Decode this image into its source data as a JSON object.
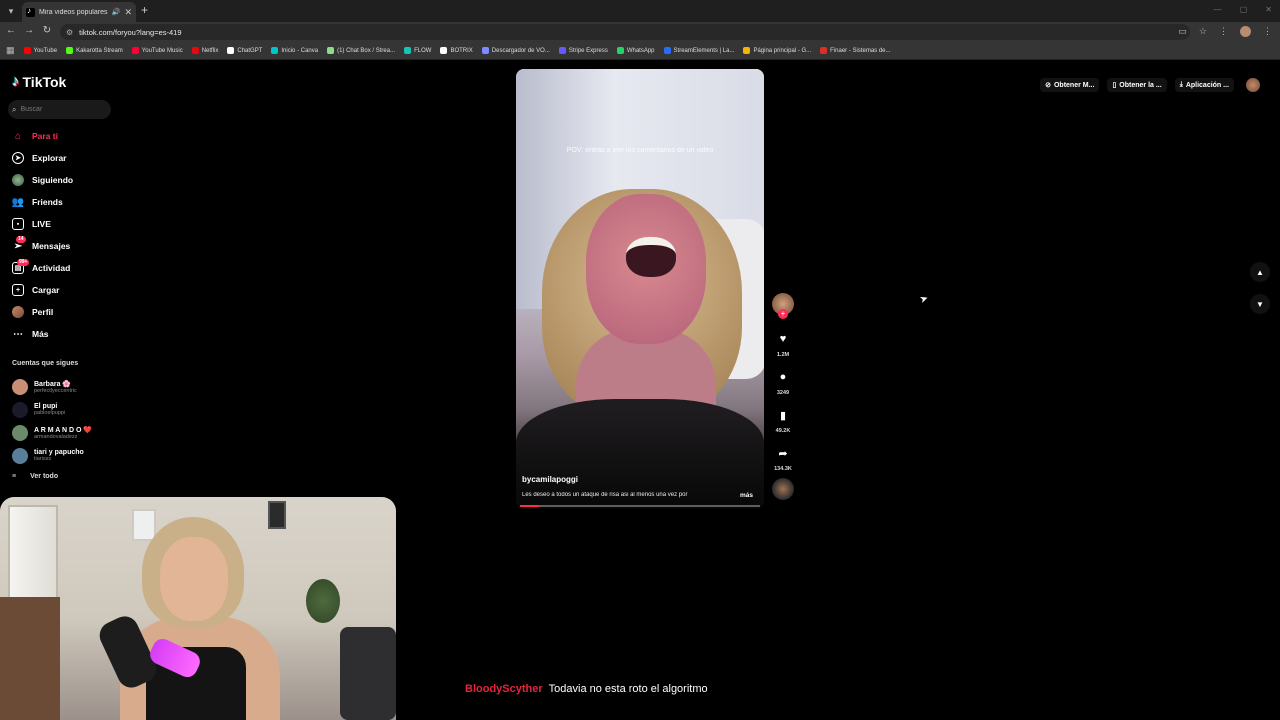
{
  "browser": {
    "tab_title": "Mira videos populares sele",
    "url": "tiktok.com/foryou?lang=es-419",
    "bookmarks": [
      {
        "label": "YouTube",
        "color": "#ff0000"
      },
      {
        "label": "Kakarotta Stream",
        "color": "#53fc18"
      },
      {
        "label": "YouTube Music",
        "color": "#ff0033"
      },
      {
        "label": "Netflix",
        "color": "#e50914"
      },
      {
        "label": "ChatGPT",
        "color": "#ffffff"
      },
      {
        "label": "Inicio - Canva",
        "color": "#00c4cc"
      },
      {
        "label": "(1) Chat Box / Strea...",
        "color": "#8bdd8b"
      },
      {
        "label": "FLOW",
        "color": "#17c3b2"
      },
      {
        "label": "BOTRIX",
        "color": "#ffffff"
      },
      {
        "label": "Descargador de VO...",
        "color": "#7c8cff"
      },
      {
        "label": "Stripe Express",
        "color": "#635bff"
      },
      {
        "label": "WhatsApp",
        "color": "#25d366"
      },
      {
        "label": "StreamElements | La...",
        "color": "#2a6df5"
      },
      {
        "label": "Página principal - G...",
        "color": "#f4b400"
      },
      {
        "label": "Finaer - Sistemas de...",
        "color": "#d93025"
      }
    ]
  },
  "tiktok": {
    "logo": "TikTok",
    "search_placeholder": "Buscar",
    "nav": [
      {
        "label": "Para ti",
        "icon": "home-icon",
        "active": true
      },
      {
        "label": "Explorar",
        "icon": "compass-icon"
      },
      {
        "label": "Siguiendo",
        "icon": "following-icon"
      },
      {
        "label": "Friends",
        "icon": "friends-icon"
      },
      {
        "label": "LIVE",
        "icon": "live-icon"
      },
      {
        "label": "Mensajes",
        "icon": "messages-icon",
        "badge": "14"
      },
      {
        "label": "Actividad",
        "icon": "activity-icon",
        "badge": "99+"
      },
      {
        "label": "Cargar",
        "icon": "upload-icon"
      },
      {
        "label": "Perfil",
        "icon": "profile-icon"
      },
      {
        "label": "Más",
        "icon": "more-icon"
      }
    ],
    "following_title": "Cuentas que sigues",
    "following": [
      {
        "name": "Barbara 🌸",
        "handle": "perfectlyeccentric",
        "color": "#c78f75"
      },
      {
        "name": "El pupi",
        "handle": "pabloelpuppi",
        "color": "#1a1a2a"
      },
      {
        "name": "A R M A N D O ❤️",
        "handle": "armandovaladezz",
        "color": "#6b8a6a"
      },
      {
        "name": "tiari y papucho",
        "handle": "tiarisss",
        "color": "#5a7f9a"
      }
    ],
    "see_all": "Ver todo",
    "top_buttons": [
      {
        "label": "Obtener M...",
        "icon": "coin-icon"
      },
      {
        "label": "Obtener la ...",
        "icon": "phone-icon"
      },
      {
        "label": "Aplicación ...",
        "icon": "download-icon"
      }
    ]
  },
  "video": {
    "overlay_text": "POV: entras a leer los comentarios de un video",
    "username": "bycamilapoggi",
    "description": "Les deseo a todos un ataque de risa asi al menos una vez por",
    "more_label": "más",
    "progress": 0.08,
    "likes": "1.2M",
    "comments": "3249",
    "saves": "49.2K",
    "shares": "134.3K"
  },
  "chat": {
    "user": "BloodyScyther",
    "message": "Todavia no esta roto el algoritmo"
  }
}
